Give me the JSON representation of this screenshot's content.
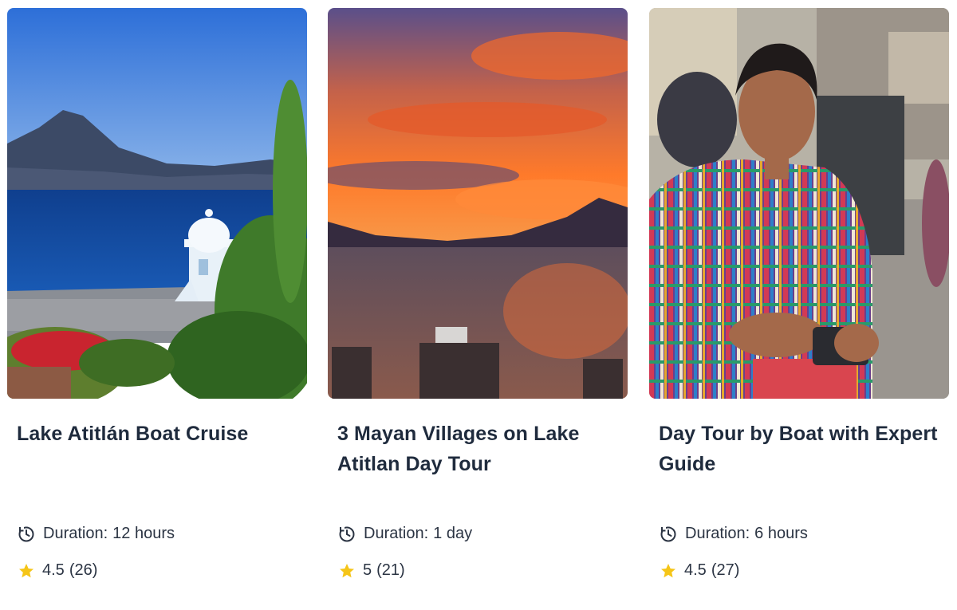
{
  "tours": [
    {
      "title": "Lake Atitlán Boat Cruise",
      "duration_label": "Duration:",
      "duration_value": "12 hours",
      "rating": "4.5",
      "reviews": "(26)",
      "image": "lake-volcano-gazebo-photo"
    },
    {
      "title": "3 Mayan Villages on Lake Atitlan Day Tour",
      "duration_label": "Duration:",
      "duration_value": "1 day",
      "rating": "5",
      "reviews": "(21)",
      "image": "sunset-lake-dock-photo"
    },
    {
      "title": "Day Tour by Boat with Expert Guide",
      "duration_label": "Duration:",
      "duration_value": "6 hours",
      "rating": "4.5",
      "reviews": "(27)",
      "image": "woman-traditional-huipil-photo"
    }
  ],
  "colors": {
    "title": "#1f2b3d",
    "meta_text": "#2b3443",
    "star": "#f5c518"
  },
  "icons": {
    "duration": "clock-icon",
    "rating": "star-icon"
  }
}
